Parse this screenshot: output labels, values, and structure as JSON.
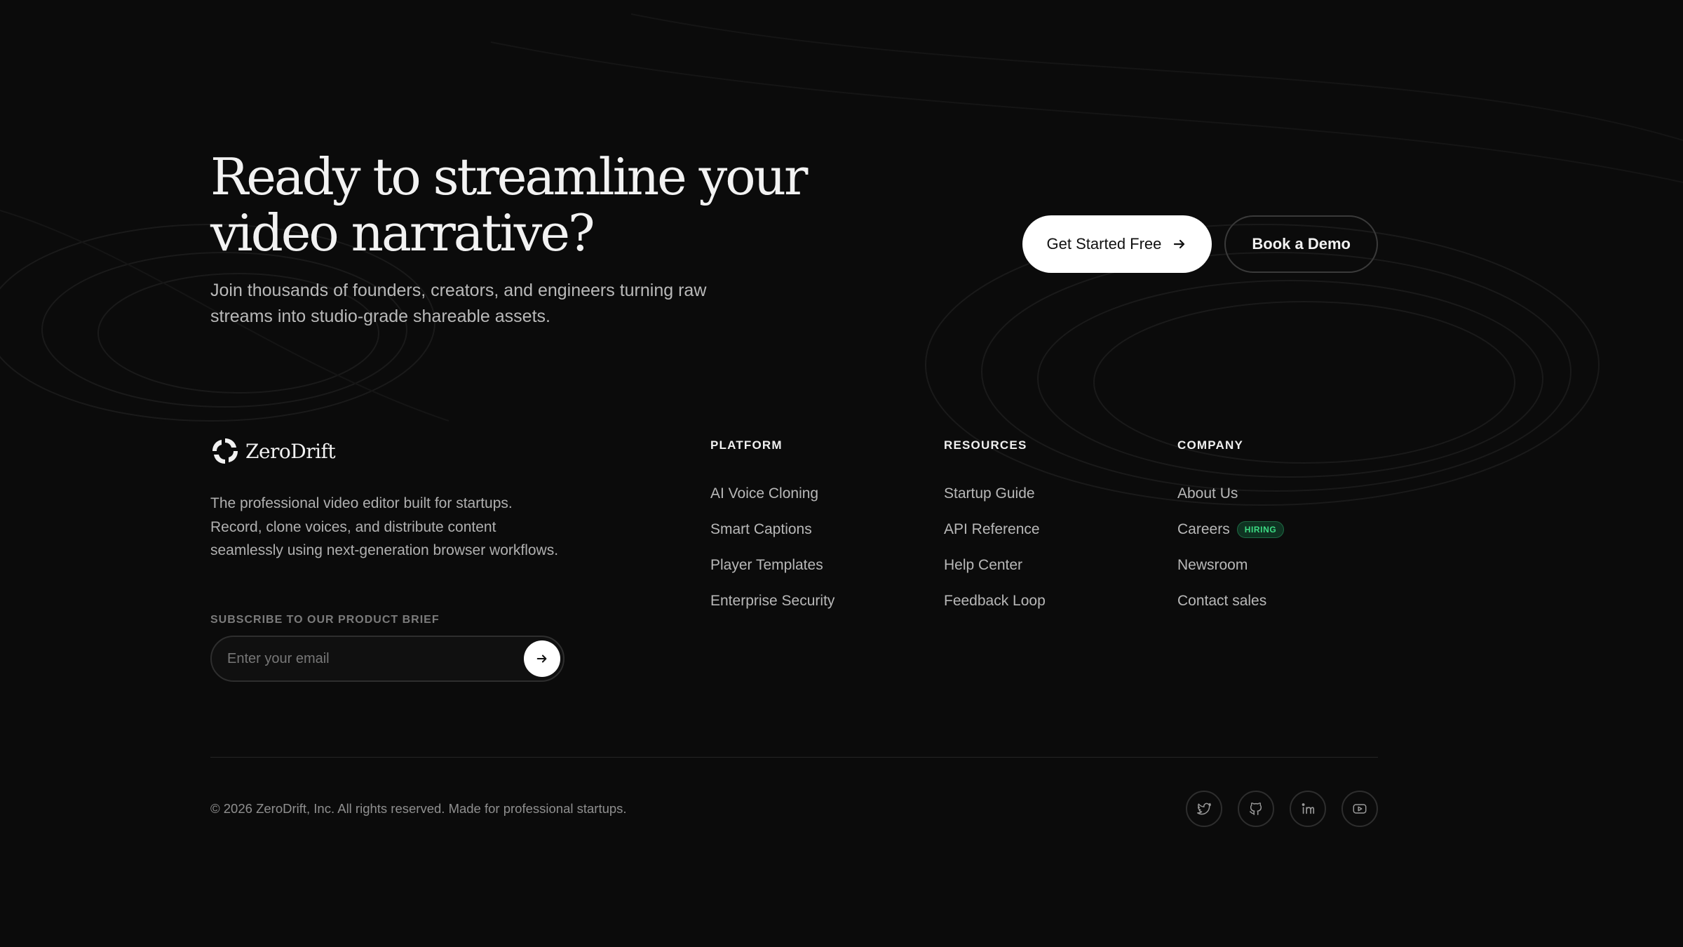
{
  "cta": {
    "title_line1": "Ready to streamline your",
    "title_line2": "video narrative?",
    "subtitle_line1": "Join thousands of founders, creators, and engineers turning raw",
    "subtitle_line2": "streams into studio-grade shareable assets.",
    "primary_label": "Get Started Free",
    "secondary_label": "Book a Demo"
  },
  "brand": {
    "name": "ZeroDrift",
    "description": "The professional video editor built for startups. Record, clone voices, and distribute content seamlessly using next-generation browser workflows.",
    "subscribe_label": "SUBSCRIBE TO OUR PRODUCT BRIEF",
    "email_placeholder": "Enter your email"
  },
  "columns": [
    {
      "heading": "PLATFORM",
      "links": [
        "AI Voice Cloning",
        "Smart Captions",
        "Player Templates",
        "Enterprise Security"
      ]
    },
    {
      "heading": "RESOURCES",
      "links": [
        "Startup Guide",
        "API Reference",
        "Help Center",
        "Feedback Loop"
      ]
    },
    {
      "heading": "COMPANY",
      "links": [
        "About Us",
        "Careers",
        "Newsroom",
        "Contact sales"
      ],
      "badge": "HIRING"
    }
  ],
  "footer": {
    "copyright": "© 2026 ZeroDrift, Inc. All rights reserved. Made for professional startups.",
    "socials": [
      "twitter-icon",
      "github-icon",
      "linkedin-icon",
      "youtube-icon"
    ]
  },
  "colors": {
    "background": "#0b0b0b",
    "accent_badge": "#3ddc84",
    "primary_button": "#ffffff"
  }
}
